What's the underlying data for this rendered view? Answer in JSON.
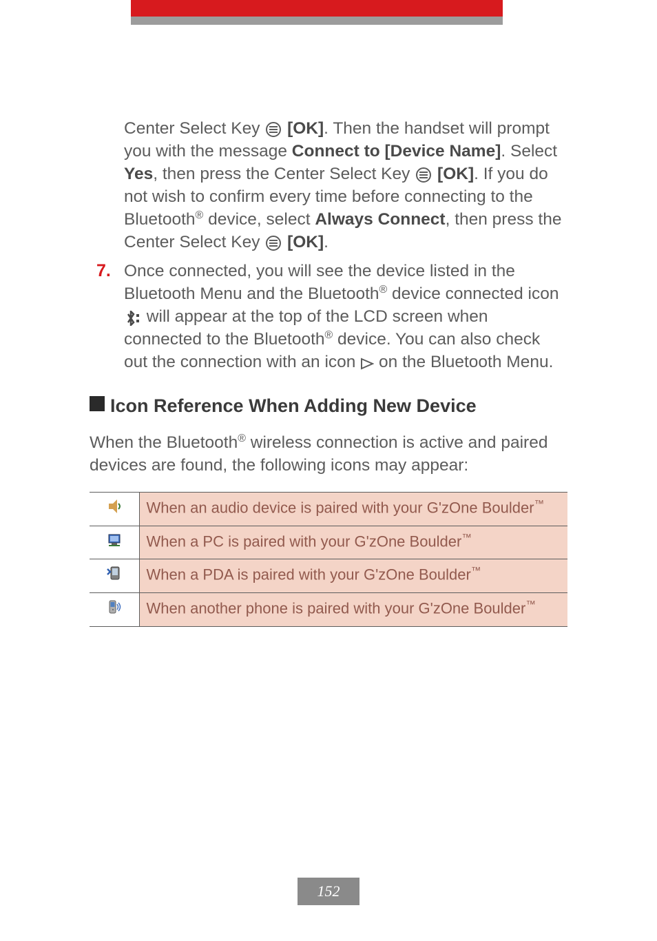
{
  "step6": {
    "part1": "Center Select Key ",
    "ok1": "[OK]",
    "part2": ". Then the handset will prompt you with the message ",
    "connect_to": "Connect to [Device Name]",
    "part3": ". Select ",
    "yes": "Yes",
    "part4": ", then press the Center Select Key ",
    "ok2": "[OK]",
    "part5": ". If you do not wish to confirm every time before connecting to the Bluetooth",
    "reg1": "®",
    "part6": " device, select ",
    "always_connect": "Always Connect",
    "part7": ", then press the Center Select Key ",
    "ok3": "[OK]",
    "part8": "."
  },
  "step7": {
    "number": "7.",
    "part1": "Once connected, you will see the device listed in the Bluetooth Menu and the Bluetooth",
    "reg1": "®",
    "part2": " device connected icon ",
    "part3": " will appear at the top of the LCD screen when connected to the Bluetooth",
    "reg2": "®",
    "part4": " device. You can also check out the connection with an icon ",
    "part5": " on the Bluetooth Menu."
  },
  "section": {
    "title": "Icon Reference When Adding New Device",
    "intro_part1": "When the Bluetooth",
    "reg": "®",
    "intro_part2": " wireless connection is active and paired devices are found, the following icons may appear:"
  },
  "table": {
    "rows": [
      {
        "desc_part1": "When an audio device is paired with your G'zOne Boulder",
        "tm": "™"
      },
      {
        "desc_part1": "When a PC is paired with your G'zOne Boulder",
        "tm": "™"
      },
      {
        "desc_part1": "When a PDA is paired with your G'zOne Boulder",
        "tm": "™"
      },
      {
        "desc_part1": "When another phone is paired with your G'zOne Boulder",
        "tm": "™"
      }
    ]
  },
  "page_number": "152"
}
